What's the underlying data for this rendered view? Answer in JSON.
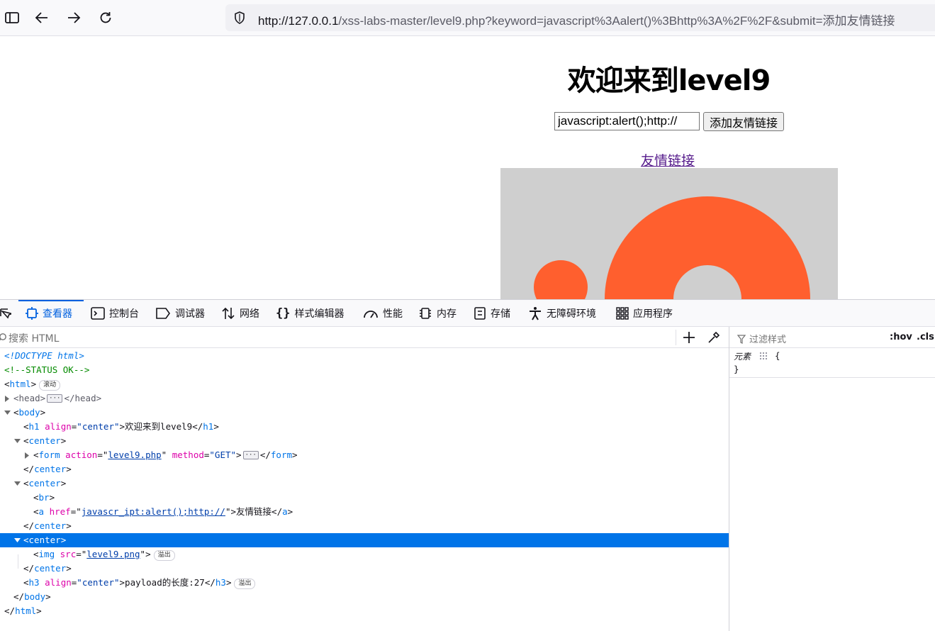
{
  "browser": {
    "url_host": "http://127.0.0.1",
    "url_path": "/xss-labs-master/level9.php?keyword=javascript%3Aalert()%3Bhttp%3A%2F%2F&submit=添加友情链接",
    "icons": [
      "sidebar-icon",
      "back-icon",
      "forward-icon",
      "reload-icon",
      "shield-icon"
    ]
  },
  "page": {
    "title": "欢迎来到level9",
    "input_value": "javascript:alert();http://",
    "submit_label": "添加友情链接",
    "link_text": "友情链接",
    "image_colors": {
      "background": "#cfcfcf",
      "shape": "#ff5f2e"
    }
  },
  "devtools": {
    "tabs": [
      {
        "label": "查看器",
        "icon": "inspector-icon"
      },
      {
        "label": "控制台",
        "icon": "console-icon"
      },
      {
        "label": "调试器",
        "icon": "debugger-icon"
      },
      {
        "label": "网络",
        "icon": "network-icon"
      },
      {
        "label": "样式编辑器",
        "icon": "style-editor-icon"
      },
      {
        "label": "性能",
        "icon": "performance-icon"
      },
      {
        "label": "内存",
        "icon": "memory-icon"
      },
      {
        "label": "存储",
        "icon": "storage-icon"
      },
      {
        "label": "无障碍环境",
        "icon": "accessibility-icon"
      },
      {
        "label": "应用程序",
        "icon": "application-icon"
      }
    ],
    "active_tab": "查看器",
    "search_placeholder": "搜索 HTML",
    "markup": {
      "doctype": "<!DOCTYPE html>",
      "comment": "<!--STATUS OK-->",
      "badge_scroll": "滚动",
      "badge_overflow": "溢出",
      "html": "html",
      "head": "head",
      "body": "body",
      "h1": "h1",
      "align": "align",
      "center_val": "\"center\"",
      "h1_text": "欢迎来到level9",
      "center": "center",
      "form": "form",
      "action": "action",
      "action_val": "level9.php",
      "method": "method",
      "method_val": "\"GET\"",
      "br": "br",
      "a": "a",
      "href": "href",
      "href_val": "javascr_ipt:alert();http://",
      "a_text": "友情链接",
      "img": "img",
      "src": "src",
      "src_val": "level9.png",
      "h3": "h3",
      "h3_text": "payload的长度:27"
    },
    "rules": {
      "filter_placeholder": "过滤样式",
      "hov": ":hov",
      "cls": ".cls",
      "selector": "元素",
      "open_brace": "{",
      "close_brace": "}"
    },
    "selected_color": "#0074e8"
  }
}
